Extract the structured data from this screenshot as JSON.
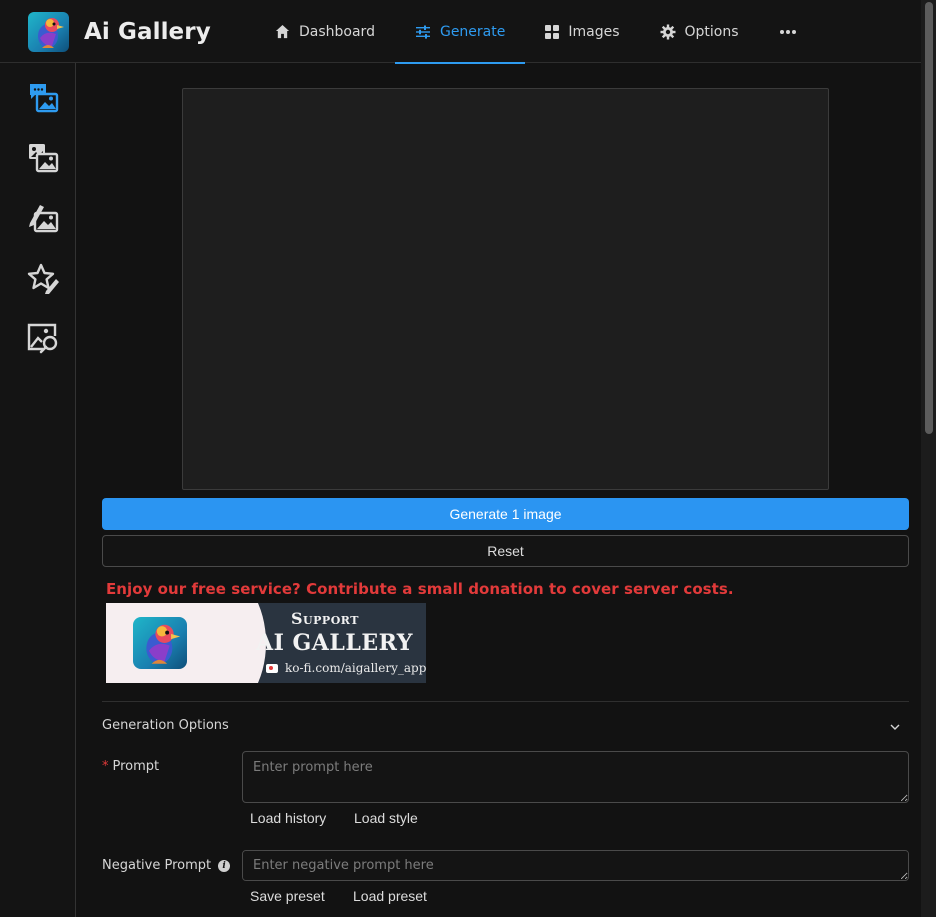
{
  "app": {
    "title": "Ai Gallery"
  },
  "nav": {
    "items": [
      {
        "label": "Dashboard",
        "icon": "home-icon"
      },
      {
        "label": "Generate",
        "icon": "sliders-icon",
        "active": true
      },
      {
        "label": "Images",
        "icon": "grid-icon"
      },
      {
        "label": "Options",
        "icon": "gear-icon"
      }
    ],
    "more_icon": "more-horizontal-icon",
    "accent_color": "#2e9bf0"
  },
  "sidebar": {
    "items": [
      {
        "icon": "text-to-image-icon",
        "active": true
      },
      {
        "icon": "image-to-image-icon"
      },
      {
        "icon": "image-edit-icon"
      },
      {
        "icon": "star-edit-icon"
      },
      {
        "icon": "image-search-icon"
      }
    ]
  },
  "actions": {
    "generate_label": "Generate 1 image",
    "reset_label": "Reset",
    "generate_color": "#2b95f2"
  },
  "donation": {
    "message": "Enjoy our free service? Contribute a small donation to cover server costs.",
    "message_color": "#e23a3a",
    "banner": {
      "support": "Support",
      "title": "AI GALLERY",
      "url": "ko-fi.com/aigallery_app"
    }
  },
  "generation_options": {
    "title": "Generation Options",
    "prompt": {
      "required_mark": "*",
      "label": "Prompt",
      "placeholder": "Enter prompt here",
      "value": "",
      "load_history": "Load history",
      "load_style": "Load style"
    },
    "negative_prompt": {
      "label": "Negative Prompt",
      "info_icon": "i",
      "placeholder": "Enter negative prompt here",
      "value": "",
      "save_preset": "Save preset",
      "load_preset": "Load preset"
    }
  }
}
